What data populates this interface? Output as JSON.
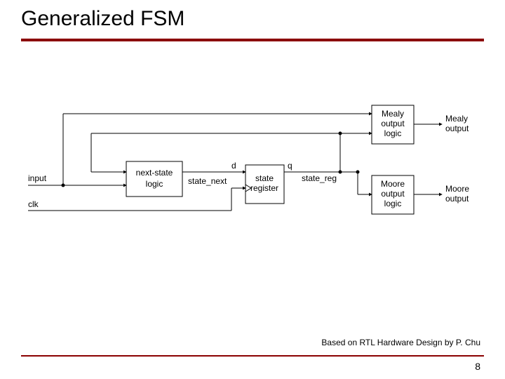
{
  "title": "Generalized FSM",
  "source": "Based on RTL Hardware Design by P. Chu",
  "page_number": "8",
  "diagram": {
    "labels": {
      "input": "input",
      "clk": "clk",
      "state_next": "state_next",
      "d": "d",
      "q": "q",
      "state_reg": "state_reg",
      "mealy_output": "Mealy output",
      "moore_output": "Moore output"
    },
    "boxes": {
      "next_state_logic_l1": "next-state",
      "next_state_logic_l2": "logic",
      "state_register_l1": "state",
      "state_register_l2": "register",
      "mealy_l1": "Mealy",
      "mealy_l2": "output",
      "mealy_l3": "logic",
      "moore_l1": "Moore",
      "moore_l2": "output",
      "moore_l3": "logic"
    }
  }
}
